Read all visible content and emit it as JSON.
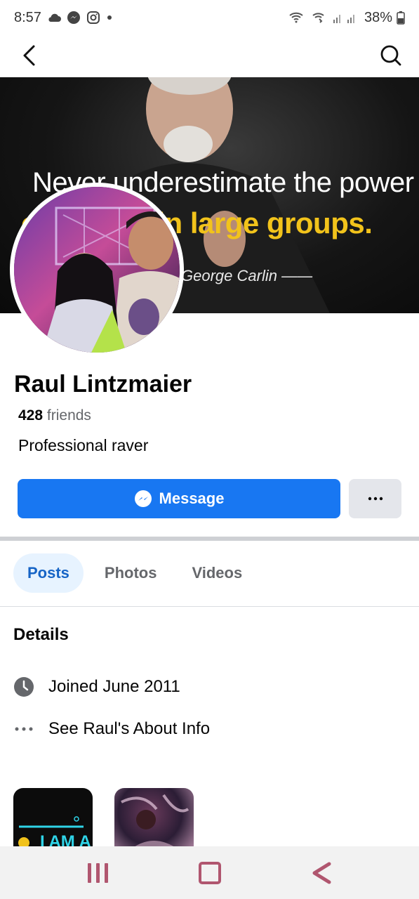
{
  "status_bar": {
    "time": "8:57",
    "battery": "38%",
    "icons": [
      "cloud-icon",
      "messenger-icon",
      "instagram-icon",
      "dot-icon",
      "wifi-calling-icon",
      "signal-icon",
      "battery-icon"
    ]
  },
  "nav": {
    "back_icon": "chevron-left-icon",
    "search_icon": "search-icon"
  },
  "cover": {
    "line1": "Never underestimate the power",
    "line2": "of people in large groups.",
    "attribution": "George Carlin ——"
  },
  "profile": {
    "name": "Raul Lintzmaier",
    "friends_count": "428",
    "friends_label": "friends",
    "bio": "Professional raver"
  },
  "actions": {
    "message_label": "Message",
    "more_label": "···"
  },
  "tabs": [
    {
      "label": "Posts",
      "active": true
    },
    {
      "label": "Photos",
      "active": false
    },
    {
      "label": "Videos",
      "active": false
    }
  ],
  "details": {
    "title": "Details",
    "items": [
      {
        "icon": "clock-icon",
        "text": "Joined June 2011"
      },
      {
        "icon": "more-dots-icon",
        "text": "See Raul's About Info"
      }
    ]
  },
  "photos": {
    "thumb1_caption": "I AM A"
  },
  "colors": {
    "accent": "#1877f2",
    "active_tab_bg": "#e7f3ff",
    "active_tab_text": "#1664c6",
    "nav_icon": "#b0566f"
  }
}
